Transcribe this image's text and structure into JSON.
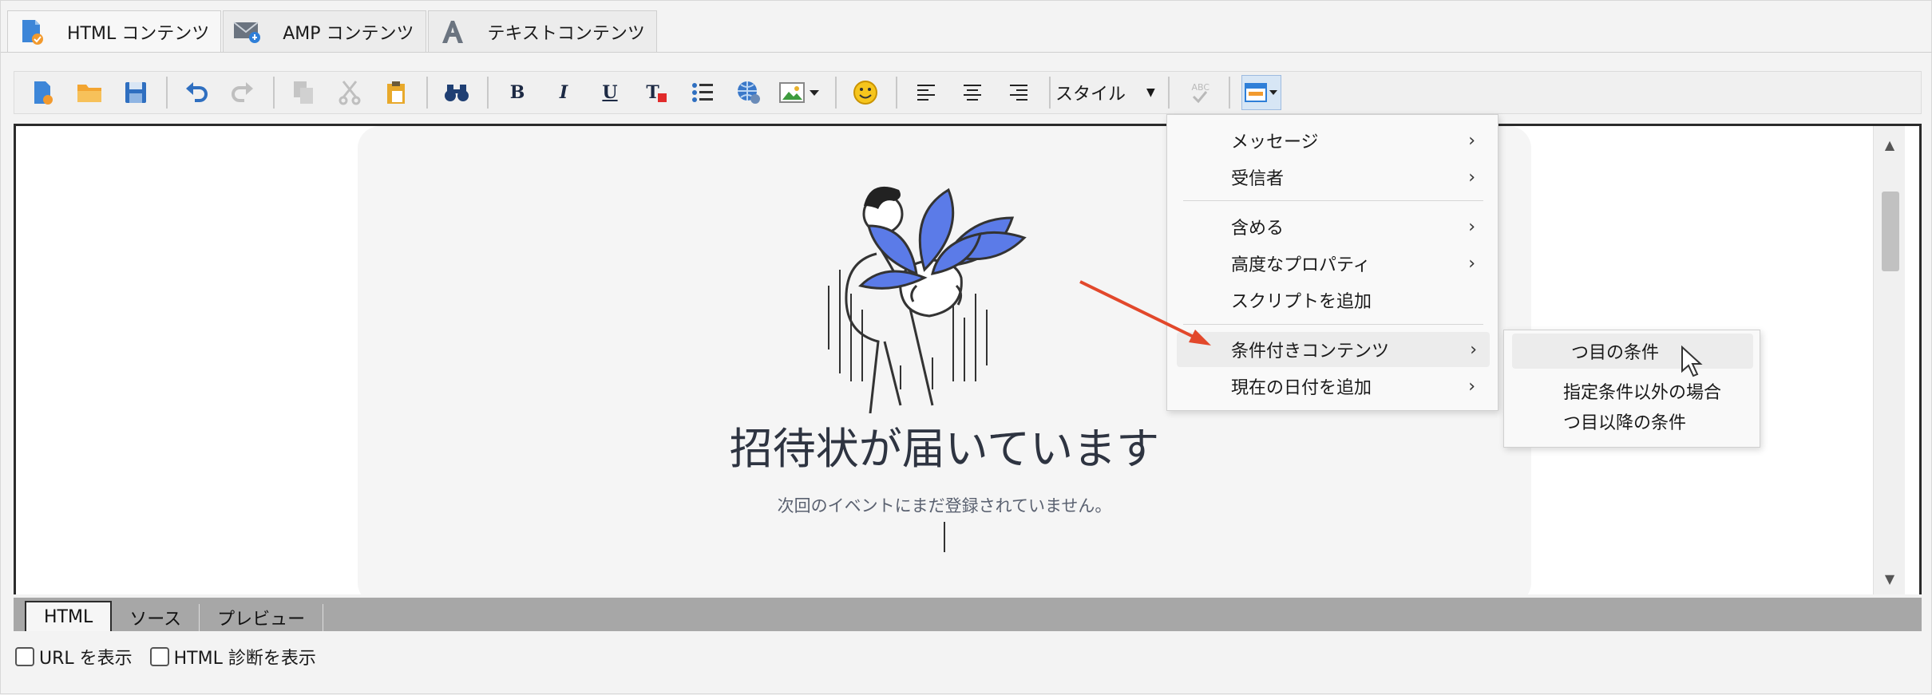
{
  "tabs": [
    {
      "label": "HTML コンテンツ",
      "icon": "html-content-icon"
    },
    {
      "label": "AMP コンテンツ",
      "icon": "amp-mail-icon"
    },
    {
      "label": "テキストコンテンツ",
      "icon": "text-a-icon"
    }
  ],
  "toolbar": {
    "style_label": "スタイル",
    "format_bold": "B",
    "format_italic": "I",
    "format_underline": "U",
    "format_text_color": "T",
    "spellcheck_text": "ABC"
  },
  "editor": {
    "heading": "招待状が届いています",
    "subtext": "次回のイベントにまだ登録されていません。"
  },
  "context_menu": {
    "items": [
      {
        "label": "メッセージ",
        "has_submenu": true
      },
      {
        "label": "受信者",
        "has_submenu": true
      },
      {
        "label": "含める",
        "has_submenu": true
      },
      {
        "label": "高度なプロパティ",
        "has_submenu": true
      },
      {
        "label": "スクリプトを追加",
        "has_submenu": false
      },
      {
        "label": "条件付きコンテンツ",
        "has_submenu": true
      },
      {
        "label": "現在の日付を追加",
        "has_submenu": true
      }
    ],
    "submenu": [
      {
        "label": "つ目の条件"
      },
      {
        "label": "指定条件以外の場合"
      },
      {
        "label": "つ目以降の条件"
      }
    ],
    "arrow_glyph": "›"
  },
  "mode_tabs": [
    "HTML",
    "ソース",
    "プレビュー"
  ],
  "checkboxes": [
    {
      "label": "URL を表示",
      "checked": false
    },
    {
      "label": "HTML 診断を表示",
      "checked": false
    }
  ],
  "colors": {
    "accent_blue": "#2f7fd8",
    "annotation_red": "#e2482b",
    "plant_blue": "#5b7be8"
  }
}
